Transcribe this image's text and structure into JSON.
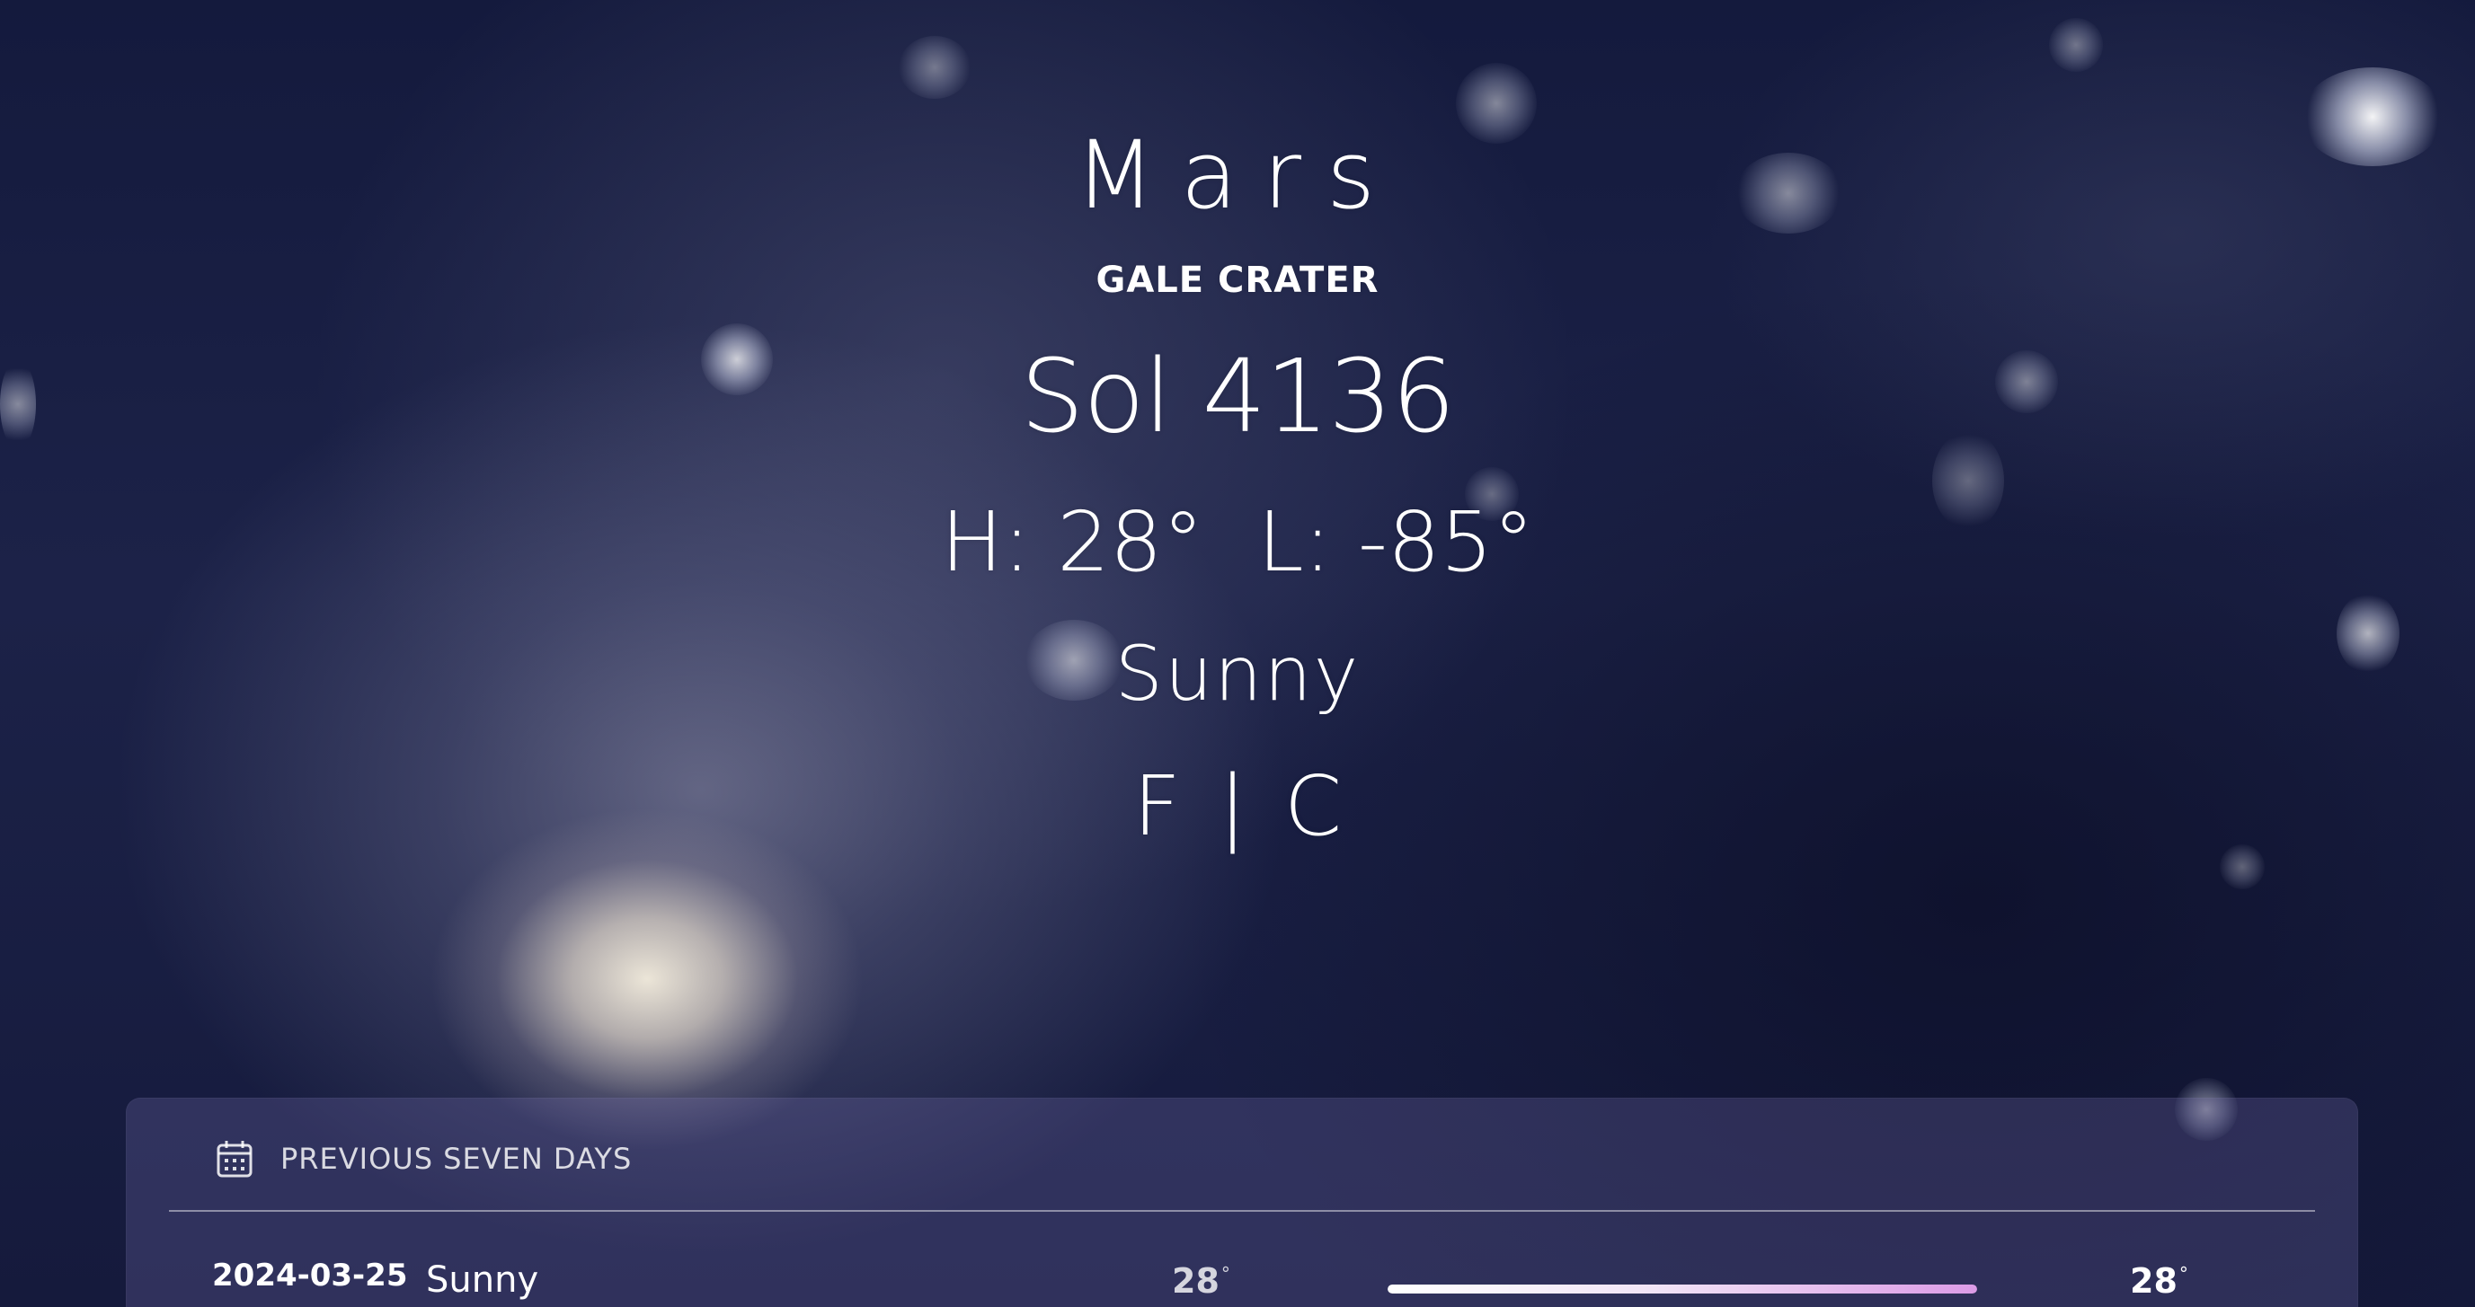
{
  "current": {
    "planet": "Mars",
    "location": "GALE CRATER",
    "sol": "Sol 4136",
    "high": "H: 28°",
    "low": "L: -85°",
    "condition": "Sunny"
  },
  "units": {
    "fahrenheit": "F",
    "separator": "|",
    "celsius": "C"
  },
  "history": {
    "title": "PREVIOUS SEVEN DAYS",
    "icon": "calendar-icon",
    "rows": [
      {
        "date": "2024-03-25",
        "condition": "Sunny",
        "low": "28",
        "high": "28",
        "degree_mark": "°",
        "range_fill": 1.0
      }
    ]
  },
  "colors": {
    "bar_start": "#ffffff",
    "bar_end": "#dc9be6",
    "panel": "rgba(120,110,175,0.28)"
  }
}
